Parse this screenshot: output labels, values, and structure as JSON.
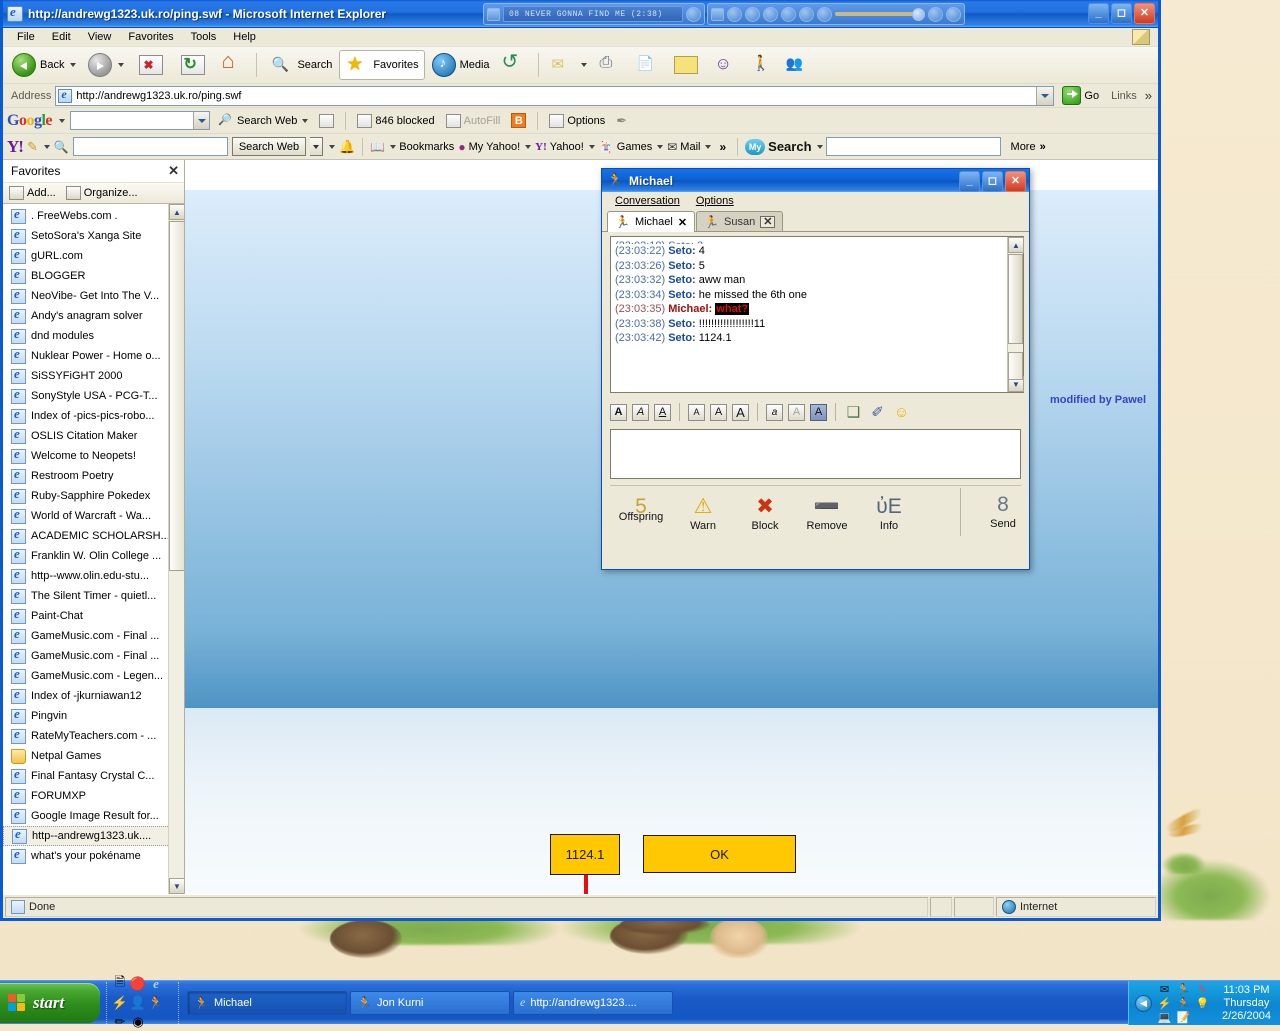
{
  "desktop": {},
  "browser": {
    "title": "http://andrewg1323.uk.ro/ping.swf - Microsoft Internet Explorer",
    "menu": [
      "File",
      "Edit",
      "View",
      "Favorites",
      "Tools",
      "Help"
    ],
    "toolbar": {
      "back": "Back",
      "search": "Search",
      "favorites": "Favorites",
      "media": "Media"
    },
    "address": {
      "label": "Address",
      "url": "http://andrewg1323.uk.ro/ping.swf",
      "go": "Go",
      "links": "Links",
      "links_more": "»"
    },
    "status": {
      "text": "Done",
      "zone": "Internet"
    }
  },
  "media_player": {
    "track": "08 NEVER GONNA FIND ME (2:38)"
  },
  "google_toolbar": {
    "logo": "Google",
    "search_web": "Search Web",
    "blocked": "846 blocked",
    "autofill": "AutoFill",
    "options": "Options",
    "search_value": ""
  },
  "yahoo_toolbar": {
    "search_value": "",
    "search_web": "Search Web",
    "bookmarks": "Bookmarks",
    "my_yahoo": "My Yahoo!",
    "yahoo": "Yahoo!",
    "games": "Games",
    "mail": "Mail",
    "overflow": "»",
    "my_search_badge": "My",
    "my_search": "Search",
    "my_search_value": "",
    "more": "More"
  },
  "favorites": {
    "title": "Favorites",
    "close": "✕",
    "add": "Add...",
    "organize": "Organize...",
    "items": [
      {
        "label": ". FreeWebs.com .",
        "type": "page"
      },
      {
        "label": "SetoSora's Xanga Site",
        "type": "page"
      },
      {
        "label": "gURL.com",
        "type": "page"
      },
      {
        "label": "BLOGGER",
        "type": "page"
      },
      {
        "label": "NeoVibe- Get Into The V...",
        "type": "page"
      },
      {
        "label": "Andy's anagram solver",
        "type": "page"
      },
      {
        "label": "dnd modules",
        "type": "page"
      },
      {
        "label": "Nuklear Power - Home o...",
        "type": "page"
      },
      {
        "label": "SiSSYFiGHT 2000",
        "type": "page"
      },
      {
        "label": "SonyStyle USA - PCG-T...",
        "type": "page"
      },
      {
        "label": "Index of -pics-pics-robo...",
        "type": "page"
      },
      {
        "label": "OSLIS Citation Maker",
        "type": "page"
      },
      {
        "label": "Welcome to Neopets!",
        "type": "page"
      },
      {
        "label": "Restroom Poetry",
        "type": "page"
      },
      {
        "label": "Ruby-Sapphire Pokedex",
        "type": "page"
      },
      {
        "label": "World of Warcraft - Wa...",
        "type": "page"
      },
      {
        "label": "ACADEMIC SCHOLARSH...",
        "type": "page"
      },
      {
        "label": "Franklin W. Olin College ...",
        "type": "page"
      },
      {
        "label": "http--www.olin.edu-stu...",
        "type": "page"
      },
      {
        "label": "The Silent Timer - quietl...",
        "type": "page"
      },
      {
        "label": "Paint-Chat",
        "type": "page"
      },
      {
        "label": "GameMusic.com - Final ...",
        "type": "page"
      },
      {
        "label": "GameMusic.com - Final ...",
        "type": "page"
      },
      {
        "label": "GameMusic.com - Legen...",
        "type": "page"
      },
      {
        "label": "Index of -jkurniawan12",
        "type": "page"
      },
      {
        "label": "Pingvin",
        "type": "page"
      },
      {
        "label": "RateMyTeachers.com - ...",
        "type": "page"
      },
      {
        "label": "Netpal Games",
        "type": "folder"
      },
      {
        "label": "Final Fantasy Crystal C...",
        "type": "page"
      },
      {
        "label": "FORUMXP",
        "type": "page"
      },
      {
        "label": "Google Image Result for...",
        "type": "page"
      },
      {
        "label": "http--andrewg1323.uk....",
        "type": "page",
        "active": true
      },
      {
        "label": "what's your pokéname",
        "type": "page"
      }
    ]
  },
  "flash_game": {
    "watermark": "modified by Pawel",
    "score": "1124.1",
    "ok_button": "OK"
  },
  "aim": {
    "title": "Michael",
    "menu": [
      "Conversation",
      "Options"
    ],
    "tabs": [
      {
        "label": "Michael",
        "active": true
      },
      {
        "label": "Susan",
        "active": false
      }
    ],
    "messages": [
      {
        "time": "(23:03:22)",
        "sender": "Seto:",
        "body": "4",
        "color": "blue"
      },
      {
        "time": "(23:03:26)",
        "sender": "Seto:",
        "body": "5",
        "color": "blue"
      },
      {
        "time": "(23:03:32)",
        "sender": "Seto:",
        "body": "aww man",
        "color": "blue"
      },
      {
        "time": "(23:03:34)",
        "sender": "Seto:",
        "body": "he missed the 6th one",
        "color": "blue"
      },
      {
        "time": "(23:03:35)",
        "sender": "Michael:",
        "body": "what?",
        "color": "red",
        "highlight": true
      },
      {
        "time": "(23:03:38)",
        "sender": "Seto:",
        "body": "!!!!!!!!!!!!!!!!!!11",
        "color": "blue"
      },
      {
        "time": "(23:03:42)",
        "sender": "Seto:",
        "body": "1124.1",
        "color": "blue"
      }
    ],
    "input_value": "",
    "format_buttons": [
      {
        "name": "bold",
        "glyph": "A"
      },
      {
        "name": "italic",
        "glyph": "A"
      },
      {
        "name": "underline",
        "glyph": "A"
      },
      {
        "name": "font-decrease",
        "glyph": "A"
      },
      {
        "name": "font-normal",
        "glyph": "A"
      },
      {
        "name": "font-increase",
        "glyph": "A"
      },
      {
        "name": "link",
        "glyph": "a"
      },
      {
        "name": "text-color",
        "glyph": "A"
      },
      {
        "name": "background-color",
        "glyph": "A"
      },
      {
        "name": "insert-image",
        "glyph": "❑"
      },
      {
        "name": "attach-file",
        "glyph": "✐"
      },
      {
        "name": "smiley",
        "glyph": "☺"
      }
    ],
    "actions": [
      {
        "label": "Offspring",
        "icon": "὆5"
      },
      {
        "label": "Warn",
        "icon": "⚠"
      },
      {
        "label": "Block",
        "icon": "✖"
      },
      {
        "label": "Remove",
        "icon": "➖"
      },
      {
        "label": "Info",
        "icon": "ὐE"
      }
    ],
    "send_label": "Send",
    "send_icon": "὞8"
  },
  "taskbar": {
    "start": "start",
    "tasks": [
      {
        "label": "Michael",
        "active": true
      },
      {
        "label": "Jon Kurni",
        "active": false
      },
      {
        "label": "http://andrewg1323....",
        "active": false
      }
    ],
    "clock": {
      "time": "11:03 PM",
      "day": "Thursday",
      "date": "2/26/2004"
    }
  }
}
